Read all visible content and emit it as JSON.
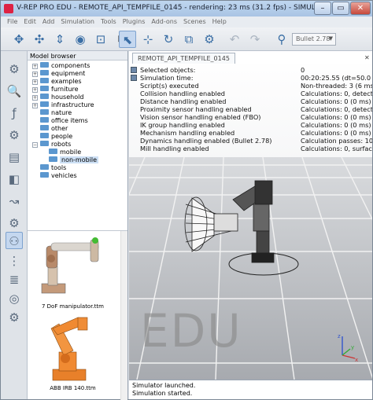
{
  "window": {
    "title": "V-REP PRO EDU - REMOTE_API_TEMPFILE_0145 - rendering: 23 ms (31.2 fps) - SIMULATION RUNNI...",
    "controls": {
      "minimize": "–",
      "maximize": "▭",
      "close": "✕"
    }
  },
  "menu": [
    "File",
    "Edit",
    "Add",
    "Simulation",
    "Tools",
    "Plugins",
    "Add-ons",
    "Scenes",
    "Help"
  ],
  "toolbar": {
    "engine_select": "Bullet 2.78",
    "icons": [
      "camera-pan-icon",
      "camera-rotate-icon",
      "camera-shift-icon",
      "camera-zoom-icon",
      "camera-fit-icon",
      "camera-angle-icon",
      "object-select-icon",
      "object-shift-icon",
      "object-rotate-icon",
      "group-icon",
      "ungroup-icon",
      "undo-icon",
      "redo-icon",
      "engine-icon"
    ]
  },
  "model_browser": {
    "header": "Model browser",
    "tree": [
      {
        "label": "components",
        "depth": 0,
        "expander": "+"
      },
      {
        "label": "equipment",
        "depth": 0,
        "expander": "+"
      },
      {
        "label": "examples",
        "depth": 0,
        "expander": "+"
      },
      {
        "label": "furniture",
        "depth": 0,
        "expander": "+"
      },
      {
        "label": "household",
        "depth": 0,
        "expander": "+"
      },
      {
        "label": "infrastructure",
        "depth": 0,
        "expander": "+"
      },
      {
        "label": "nature",
        "depth": 0,
        "expander": ""
      },
      {
        "label": "office items",
        "depth": 0,
        "expander": ""
      },
      {
        "label": "other",
        "depth": 0,
        "expander": ""
      },
      {
        "label": "people",
        "depth": 0,
        "expander": ""
      },
      {
        "label": "robots",
        "depth": 0,
        "expander": "−"
      },
      {
        "label": "mobile",
        "depth": 1,
        "expander": ""
      },
      {
        "label": "non-mobile",
        "depth": 1,
        "expander": "",
        "selected": true
      },
      {
        "label": "tools",
        "depth": 0,
        "expander": ""
      },
      {
        "label": "vehicles",
        "depth": 0,
        "expander": ""
      }
    ],
    "thumbnails": [
      {
        "caption": "7 DoF manipulator.ttm"
      },
      {
        "caption": "ABB IRB 140.ttm"
      }
    ]
  },
  "scene": {
    "tab_label": "REMOTE_API_TEMPFILE_0145",
    "info": [
      {
        "key": "Selected objects:",
        "value": "0"
      },
      {
        "key": "Simulation time:",
        "value": "00:20:25.55 (dt=50.0 m"
      },
      {
        "key": "Script(s) executed",
        "value": "Non-threaded: 3 (6 ms"
      },
      {
        "key": "Collision handling enabled",
        "value": "Calculations: 0, detect"
      },
      {
        "key": "Distance handling enabled",
        "value": "Calculations: 0 (0 ms)"
      },
      {
        "key": "Proximity sensor handling enabled",
        "value": "Calculations: 0, detect"
      },
      {
        "key": "Vision sensor handling enabled (FBO)",
        "value": "Calculations: 0 (0 ms)"
      },
      {
        "key": "IK group handling enabled",
        "value": "Calculations: 0 (0 ms)"
      },
      {
        "key": "Mechanism handling enabled",
        "value": "Calculations: 0 (0 ms)"
      },
      {
        "key": "Dynamics handling enabled (Bullet 2.78)",
        "value": "Calculation passes: 10"
      },
      {
        "key": "Mill handling enabled",
        "value": "Calculations: 0, surfac"
      }
    ],
    "watermark": "EDU",
    "axes": {
      "z": "z",
      "x": "x",
      "y": "y"
    }
  },
  "status": [
    "Simulator launched.",
    "Simulation started."
  ]
}
